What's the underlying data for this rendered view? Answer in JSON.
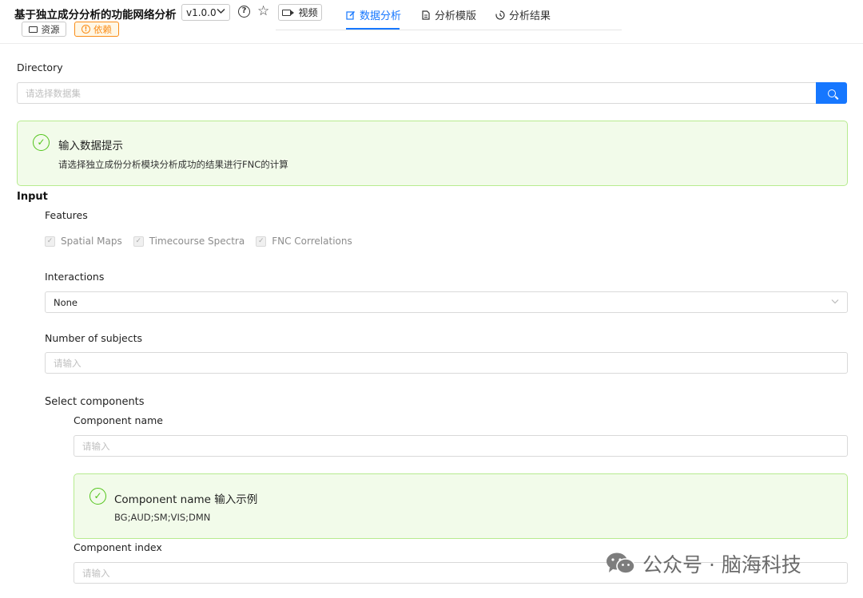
{
  "header": {
    "app_title": "基于独立成分分析的功能网络分析",
    "version": "v1.0.0",
    "video_label": "视频",
    "resources_label": "资源",
    "dependencies_label": "依赖",
    "tabs": [
      {
        "label": "数据分析",
        "icon": "edit-icon",
        "active": true
      },
      {
        "label": "分析模版",
        "icon": "file-icon",
        "active": false
      },
      {
        "label": "分析结果",
        "icon": "history-icon",
        "active": false
      }
    ],
    "accent_color": "#1677ff",
    "warning_color": "#fa8c16"
  },
  "directory": {
    "label": "Directory",
    "placeholder": "请选择数据集"
  },
  "input_hint": {
    "title": "输入数据提示",
    "description": "请选择独立成份分析模块分析成功的结果进行FNC的计算",
    "color": "#52c41a"
  },
  "input_section": {
    "title": "Input",
    "features": {
      "label": "Features",
      "options": [
        "Spatial Maps",
        "Timecourse Spectra",
        "FNC Correlations"
      ]
    },
    "interactions": {
      "label": "Interactions",
      "value": "None"
    },
    "num_subjects": {
      "label": "Number of subjects",
      "placeholder": "请输入"
    },
    "select_components": {
      "label": "Select components",
      "component_name": {
        "label": "Component name",
        "placeholder": "请输入"
      },
      "example": {
        "title": "Component name 输入示例",
        "value": "BG;AUD;SM;VIS;DMN"
      },
      "component_index": {
        "label": "Component index",
        "placeholder": "请输入"
      }
    }
  },
  "watermark": "公众号 · 脑海科技"
}
